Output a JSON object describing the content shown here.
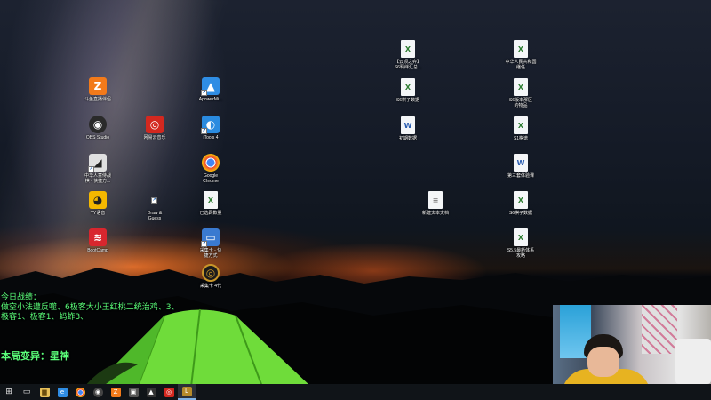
{
  "desktop": {
    "icons": [
      {
        "id": "icon-0",
        "label": "【云顶之弈】\nS6羁绊汇总...",
        "glyph": "X",
        "kind": "doc"
      },
      {
        "id": "icon-1",
        "label": "中华人民共和国\n继任",
        "glyph": "X",
        "kind": "doc"
      },
      {
        "id": "icon-2",
        "label": "斗鱼直播伴侣",
        "glyph": "Z",
        "kind": "app",
        "color": "#f27a1a"
      },
      {
        "id": "icon-3",
        "label": "ApowerMi...",
        "glyph": "▲",
        "kind": "app",
        "color": "#2f8de4"
      },
      {
        "id": "icon-4",
        "label": "S6棋子数据",
        "glyph": "X",
        "kind": "doc"
      },
      {
        "id": "icon-5",
        "label": "S6版本那区\n的物品",
        "glyph": "X",
        "kind": "doc"
      },
      {
        "id": "icon-6",
        "label": "OBS Studio",
        "glyph": "◉",
        "kind": "app",
        "color": "#2a2a2a"
      },
      {
        "id": "icon-7",
        "label": "网易云音乐",
        "glyph": "◎",
        "kind": "app",
        "color": "#d3281f"
      },
      {
        "id": "icon-8",
        "label": "iTools 4",
        "glyph": "◐",
        "kind": "app",
        "color": "#2a8be0"
      },
      {
        "id": "icon-9",
        "label": "初期数据",
        "glyph": "W",
        "kind": "doc"
      },
      {
        "id": "icon-10",
        "label": "S1棋谱",
        "glyph": "X",
        "kind": "doc"
      },
      {
        "id": "icon-11",
        "label": "中华人童侍战\n棋 - 快捷方...",
        "glyph": "◢",
        "kind": "app",
        "color": "#e0e0e0"
      },
      {
        "id": "icon-12",
        "label": "Google\nChrome",
        "glyph": "●",
        "kind": "app",
        "color": "#4285f4"
      },
      {
        "id": "icon-13",
        "label": "第三套体验课",
        "glyph": "W",
        "kind": "doc",
        "variant": "word"
      },
      {
        "id": "icon-14",
        "label": "YY语音",
        "glyph": "◕",
        "kind": "app",
        "color": "#f5b800"
      },
      {
        "id": "icon-15",
        "label": "Draw &\nGuess",
        "glyph": "",
        "kind": "shortcut"
      },
      {
        "id": "icon-16",
        "label": "已选羁数量",
        "glyph": "X",
        "kind": "doc"
      },
      {
        "id": "icon-17",
        "label": "新建文本文档",
        "glyph": "≡",
        "kind": "doc",
        "variant": "txt"
      },
      {
        "id": "icon-18",
        "label": "S6棋子数据",
        "glyph": "X",
        "kind": "doc"
      },
      {
        "id": "icon-19",
        "label": "采集卡 - 快\n捷方式",
        "glyph": "▭",
        "kind": "app",
        "color": "#3a7ad0"
      },
      {
        "id": "icon-20",
        "label": "S5.5最新体系\n攻略",
        "glyph": "X",
        "kind": "doc"
      },
      {
        "id": "icon-21",
        "label": "BootCamp",
        "glyph": "≋",
        "kind": "app",
        "color": "#d8262e"
      },
      {
        "id": "icon-22",
        "label": "采集卡 4代",
        "glyph": "◎",
        "kind": "app",
        "color": "#1c1c1c"
      }
    ]
  },
  "overlay": {
    "header": "今日战绩：",
    "lines": [
      "做空小法遭反噬、6极客大小王红桃二统治鸡、3、",
      "极客1、极客1、蚂蚱3、"
    ],
    "variant": "本局变异：星神"
  },
  "taskbar": {
    "items": [
      {
        "name": "start-button",
        "glyph": "⊞"
      },
      {
        "name": "task-view-button",
        "glyph": "▭"
      },
      {
        "name": "file-explorer-button",
        "glyph": "▆",
        "color": "#e8c15a"
      },
      {
        "name": "edge-button",
        "glyph": "e",
        "color": "#2f8de4"
      },
      {
        "name": "chrome-button",
        "glyph": "●",
        "color": "#4285f4"
      },
      {
        "name": "obs-button",
        "glyph": "◉",
        "color": "#444"
      },
      {
        "name": "douyu-button",
        "glyph": "Z",
        "color": "#f27a1a"
      },
      {
        "name": "capture-button",
        "glyph": "▣",
        "color": "#555"
      },
      {
        "name": "photos-button",
        "glyph": "▲",
        "color": "#333"
      },
      {
        "name": "netease-music-button",
        "glyph": "◎",
        "color": "#d3281f"
      },
      {
        "name": "game-button",
        "glyph": "L",
        "color": "#b58a2a",
        "active": true
      }
    ]
  }
}
